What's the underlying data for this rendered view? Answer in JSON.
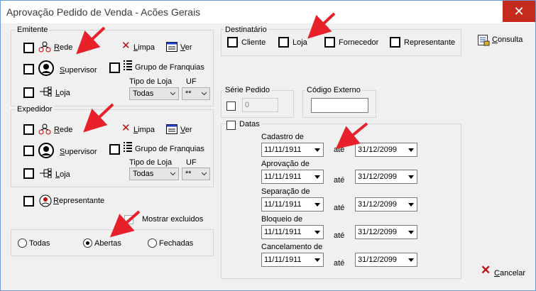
{
  "window": {
    "title": "Aprovação Pedido de Venda - Acões Gerais",
    "close_glyph": "✕"
  },
  "emitente": {
    "label": "Emitente",
    "rede": "Rede",
    "supervisor": "Supervisor",
    "loja": "Loja",
    "limpa": "Limpa",
    "ver": "Ver",
    "grupo": "Grupo de Franquias",
    "tipo_loja_label": "Tipo de Loja",
    "tipo_loja_value": "Todas",
    "uf_label": "UF",
    "uf_value": "**"
  },
  "expedidor": {
    "label": "Expedidor",
    "rede": "Rede",
    "supervisor": "Supervisor",
    "loja": "Loja",
    "limpa": "Limpa",
    "ver": "Ver",
    "grupo": "Grupo de Franquias",
    "tipo_loja_label": "Tipo de Loja",
    "tipo_loja_value": "Todas",
    "uf_label": "UF",
    "uf_value": "**"
  },
  "representante": "Representante",
  "mostrar_excluidos": "Mostrar excluidos",
  "status_radios": {
    "todas": "Todas",
    "abertas": "Abertas",
    "fechadas": "Fechadas",
    "selected": "abertas"
  },
  "destinatario": {
    "label": "Destinatário",
    "cliente": "Cliente",
    "loja": "Loja",
    "fornecedor": "Fornecedor",
    "representante": "Representante"
  },
  "serie_pedido": {
    "label": "Série Pedido",
    "value": "0"
  },
  "codigo_externo": {
    "label": "Código Externo",
    "value": ""
  },
  "datas": {
    "label": "Datas",
    "ate": "até",
    "rows": [
      {
        "label": "Cadastro de",
        "from": "11/11/1911",
        "to": "31/12/2099"
      },
      {
        "label": "Aprovação de",
        "from": "11/11/1911",
        "to": "31/12/2099"
      },
      {
        "label": "Separação de",
        "from": "11/11/1911",
        "to": "31/12/2099"
      },
      {
        "label": "Bloqueio de",
        "from": "11/11/1911",
        "to": "31/12/2099"
      },
      {
        "label": "Cancelamento de",
        "from": "11/11/1911",
        "to": "31/12/2099"
      }
    ]
  },
  "buttons": {
    "consulta": "Consulta",
    "cancelar": "Cancelar"
  },
  "colors": {
    "annotation_red": "#e8202a",
    "title_blue": "#6f9ad6",
    "close_red": "#c42b1c"
  }
}
